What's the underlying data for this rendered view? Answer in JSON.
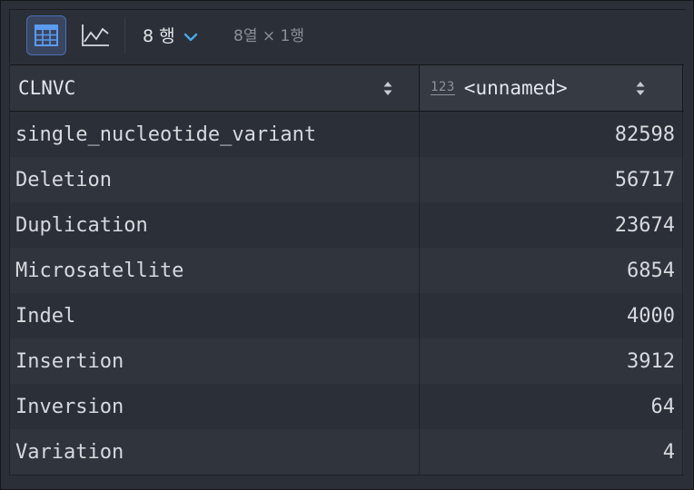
{
  "toolbar": {
    "view_buttons": [
      {
        "name": "table-view",
        "icon": "grid-table-icon",
        "active": true
      },
      {
        "name": "chart-view",
        "icon": "line-chart-icon",
        "active": false
      }
    ],
    "rows_label": "8 행",
    "dims_label": "8열 × 1행"
  },
  "table": {
    "columns": [
      {
        "label": "CLNVC",
        "type_badge": ""
      },
      {
        "label": "<unnamed>",
        "type_badge": "123"
      }
    ],
    "rows": [
      [
        "single_nucleotide_variant",
        "82598"
      ],
      [
        "Deletion",
        "56717"
      ],
      [
        "Duplication",
        "23674"
      ],
      [
        "Microsatellite",
        "6854"
      ],
      [
        "Indel",
        "4000"
      ],
      [
        "Insertion",
        "3912"
      ],
      [
        "Inversion",
        "64"
      ],
      [
        "Variation",
        "4"
      ]
    ]
  },
  "colors": {
    "accent": "#4a6fb2",
    "icon_blue": "#5b9bf0",
    "chevron": "#4aa8ea"
  }
}
